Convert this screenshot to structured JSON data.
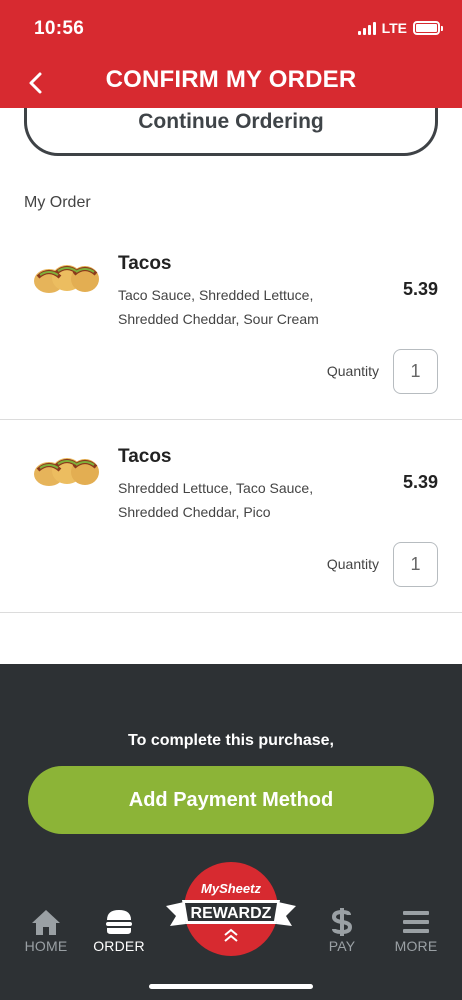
{
  "status_bar": {
    "time": "10:56",
    "network": "LTE"
  },
  "header": {
    "title": "CONFIRM MY ORDER"
  },
  "continue_button": {
    "label": "Continue Ordering"
  },
  "order": {
    "section_label": "My Order",
    "quantity_label": "Quantity",
    "items": [
      {
        "name": "Tacos",
        "desc_line1": "Taco Sauce, Shredded Lettuce,",
        "desc_line2": "Shredded Cheddar, Sour Cream",
        "price": "5.39",
        "quantity": "1"
      },
      {
        "name": "Tacos",
        "desc_line1": "Shredded Lettuce, Taco Sauce,",
        "desc_line2": "Shredded Cheddar, Pico",
        "price": "5.39",
        "quantity": "1"
      }
    ]
  },
  "checkout": {
    "prompt": "To complete this purchase,",
    "payment_button": "Add Payment Method"
  },
  "tabbar": {
    "home": "HOME",
    "order": "ORDER",
    "rewards_logo_top": "MySheetz",
    "rewards_logo_banner": "REWARDZ",
    "pay": "PAY",
    "more": "MORE"
  },
  "colors": {
    "header_red": "#d72a30",
    "panel_dark": "#2d3134",
    "accent_green": "#8cb437"
  }
}
